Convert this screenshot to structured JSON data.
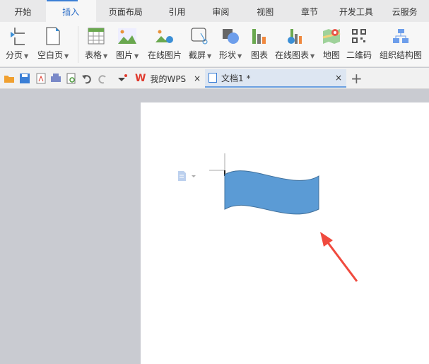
{
  "menu_tabs": [
    "开始",
    "插入",
    "页面布局",
    "引用",
    "审阅",
    "视图",
    "章节",
    "开发工具",
    "云服务"
  ],
  "active_tab": "插入",
  "ribbon": [
    {
      "label": "分页",
      "dropdown": true,
      "icon": "page-break-icon"
    },
    {
      "label": "空白页",
      "dropdown": true,
      "icon": "blank-page-icon"
    },
    {
      "label": "表格",
      "dropdown": true,
      "icon": "table-icon"
    },
    {
      "label": "图片",
      "dropdown": true,
      "icon": "picture-icon"
    },
    {
      "label": "在线图片",
      "dropdown": false,
      "icon": "online-picture-icon"
    },
    {
      "label": "截屏",
      "dropdown": true,
      "icon": "screenshot-icon"
    },
    {
      "label": "形状",
      "dropdown": true,
      "icon": "shapes-icon"
    },
    {
      "label": "图表",
      "dropdown": false,
      "icon": "chart-icon"
    },
    {
      "label": "在线图表",
      "dropdown": true,
      "icon": "online-chart-icon"
    },
    {
      "label": "地图",
      "dropdown": false,
      "icon": "map-icon"
    },
    {
      "label": "二维码",
      "dropdown": false,
      "icon": "qrcode-icon"
    },
    {
      "label": "组织结构图",
      "dropdown": false,
      "icon": "org-chart-icon"
    }
  ],
  "doc_tabs": [
    {
      "label": "我的WPS",
      "close": "×"
    },
    {
      "label": "文档1 *",
      "close": "×"
    }
  ],
  "new_tab": "+",
  "colors": {
    "accent": "#2b6dc7",
    "shape_fill": "#5b9bd5",
    "shape_stroke": "#41719c",
    "arrow": "#f04a3e"
  }
}
